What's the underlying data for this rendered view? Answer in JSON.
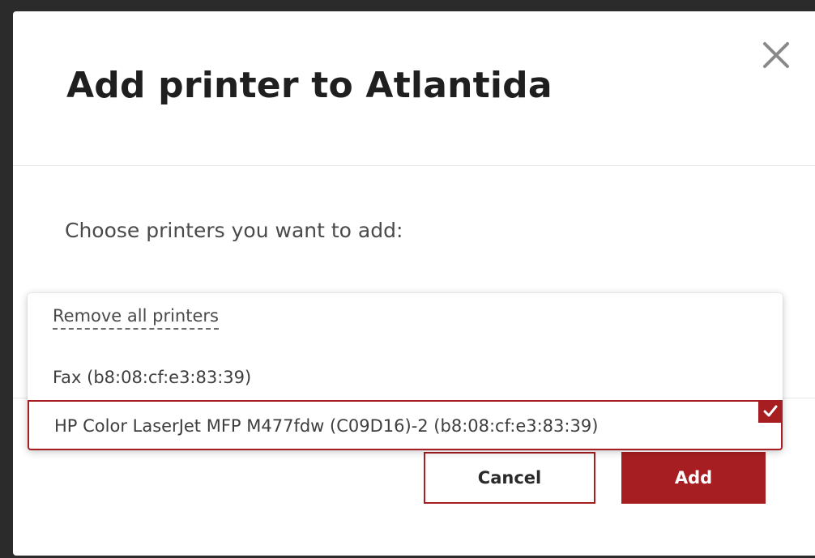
{
  "modal": {
    "title": "Add printer to Atlantida",
    "close_icon": "close-icon",
    "prompt": "Choose printers you want to add:"
  },
  "dropdown": {
    "remove_all_label": "Remove all printers",
    "options": [
      {
        "label": "Fax (b8:08:cf:e3:83:39)",
        "selected": false
      },
      {
        "label": "HP Color LaserJet MFP M477fdw (C09D16)-2 (b8:08:cf:e3:83:39)",
        "selected": true
      }
    ],
    "check_icon": "checkmark-icon"
  },
  "footer": {
    "cancel_label": "Cancel",
    "add_label": "Add"
  },
  "colors": {
    "accent": "#a61e22",
    "backdrop": "#2b2b2b",
    "text": "#1f1f1f"
  }
}
